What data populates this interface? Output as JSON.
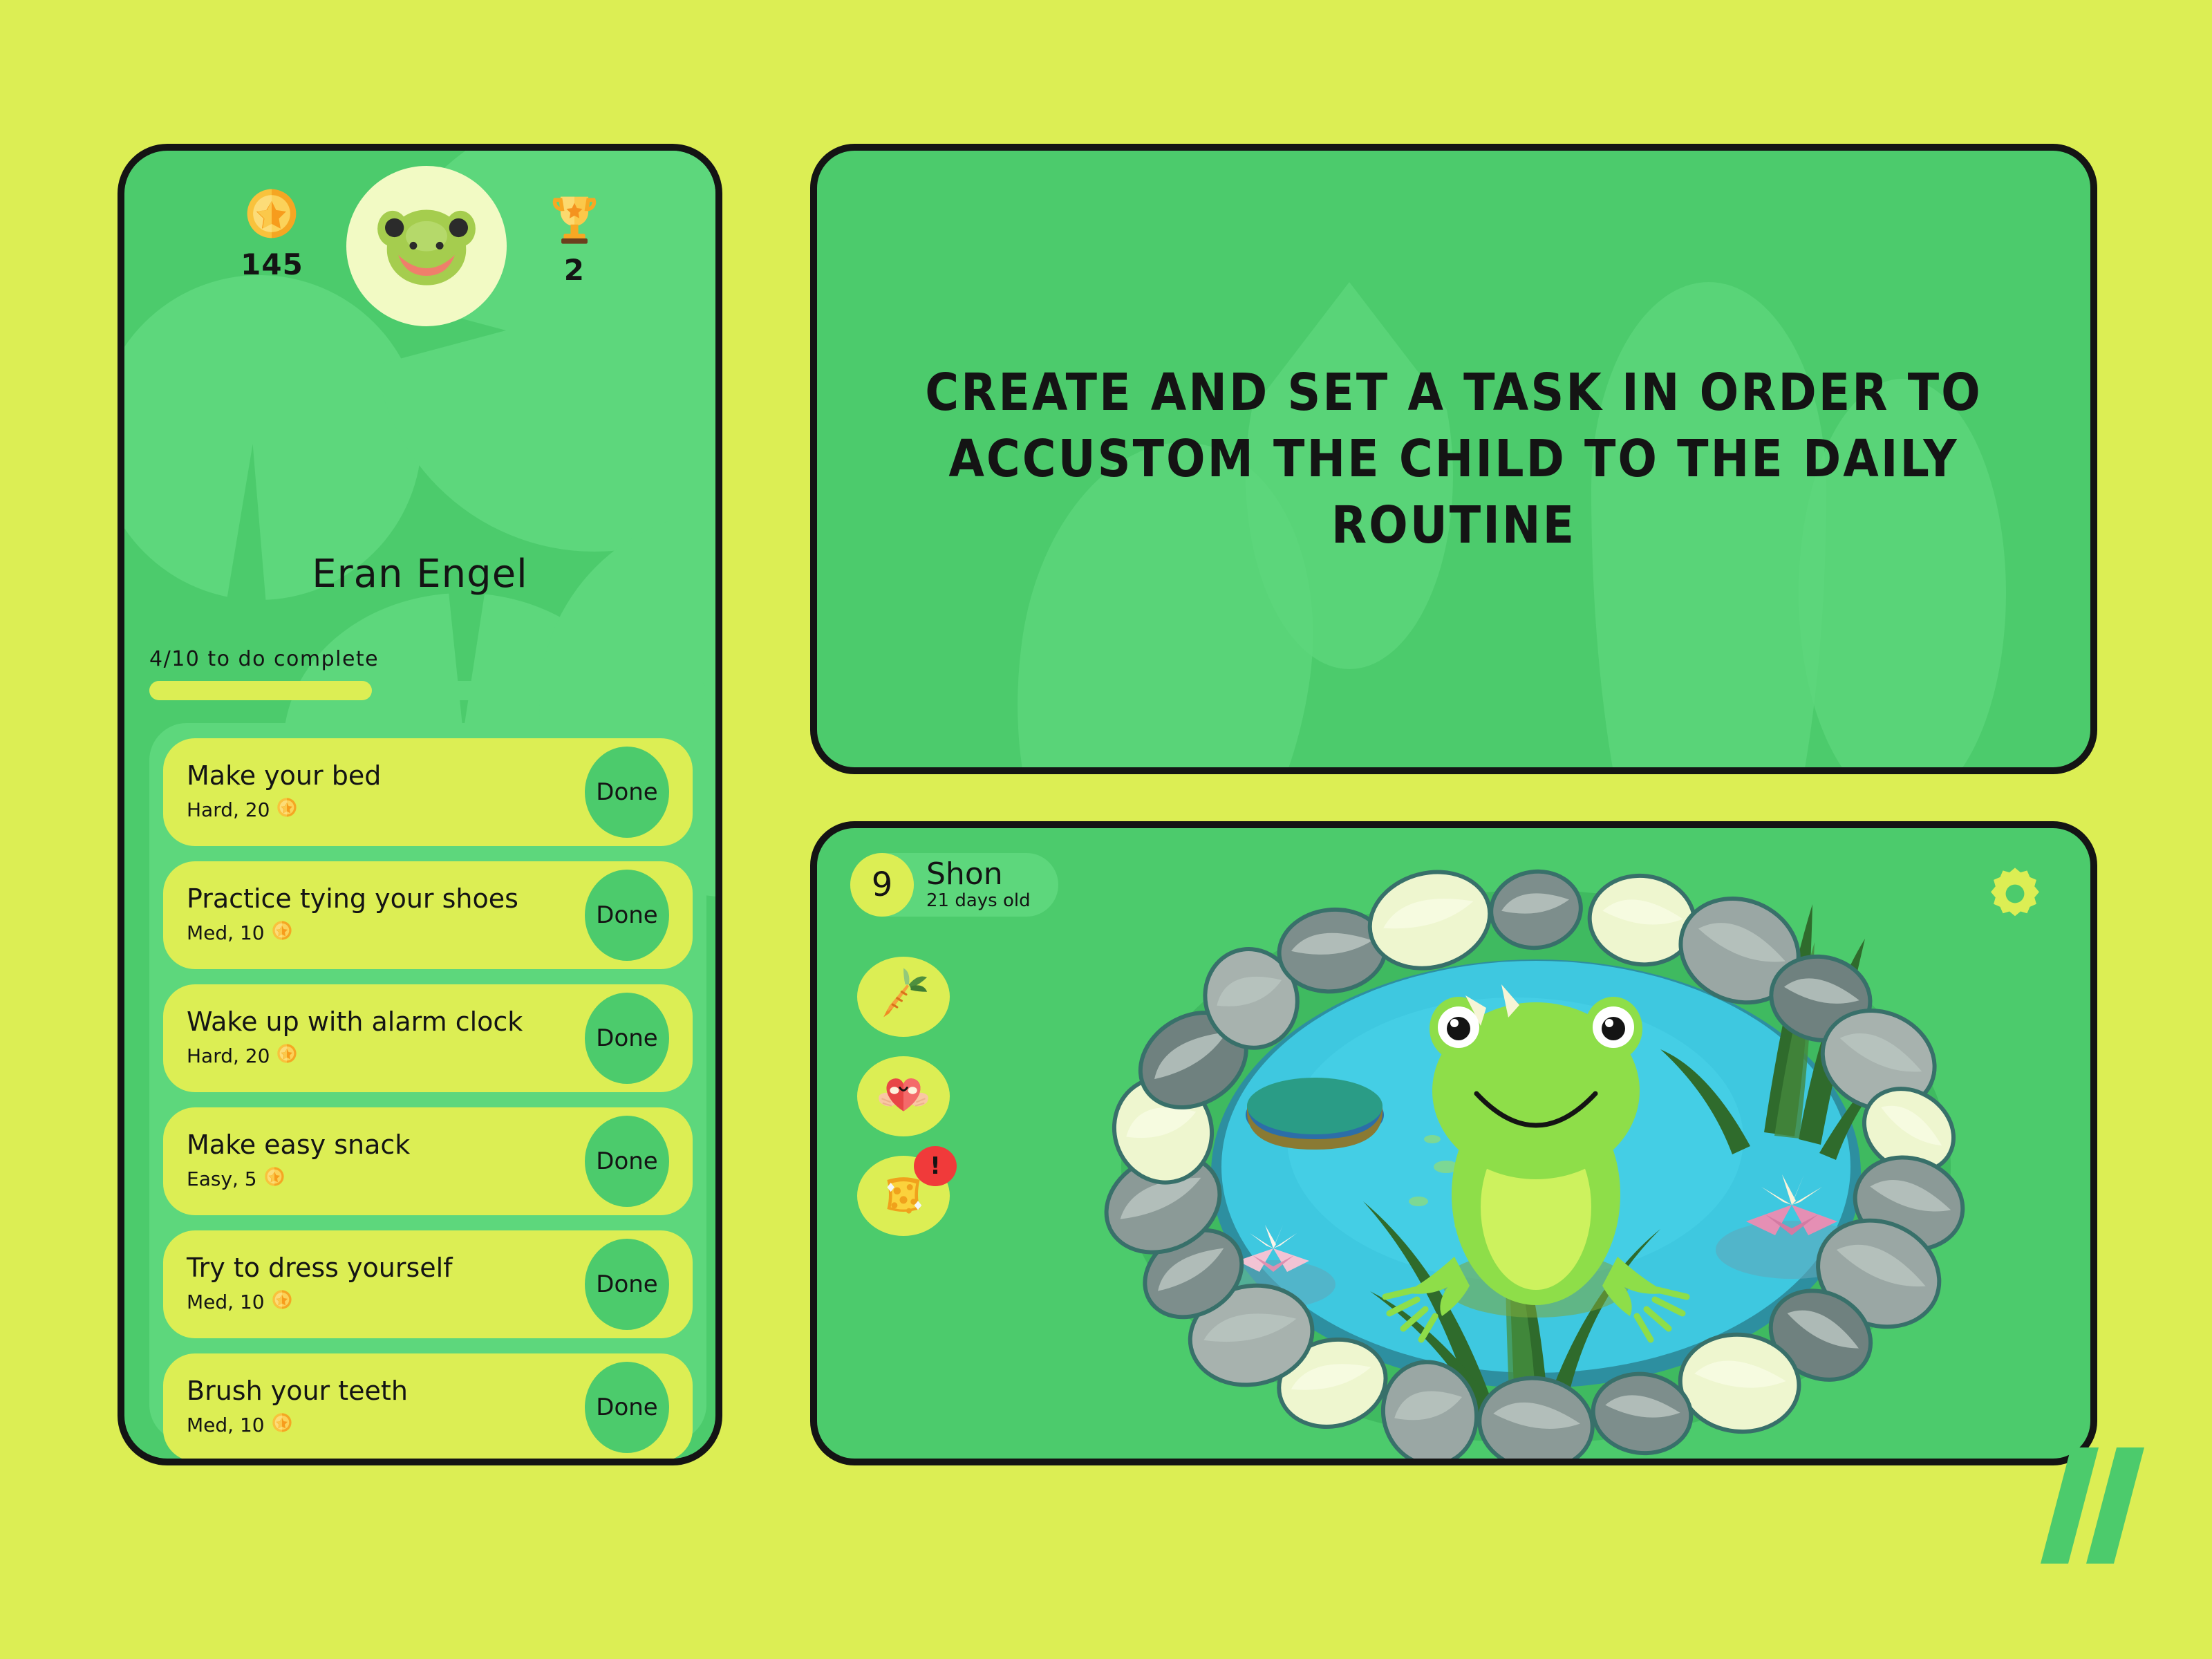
{
  "theme": {
    "bg": "#dcee54",
    "panel_green": "#4ccb6c",
    "panel_green_light": "#5dd77c",
    "card_yellow": "#dcee54",
    "ink": "#141414",
    "alert_red": "#f03a3a",
    "coin_gold": "#f7b731",
    "pond_water": "#3ec8e0"
  },
  "profile": {
    "coins_icon": "coin-star-icon",
    "coins": "145",
    "avatar_icon": "frog-avatar-icon",
    "trophy_icon": "trophy-icon",
    "trophies": "2",
    "name": "Eran Engel",
    "progress_label": "4/10 to do complete",
    "progress_done": 4,
    "progress_total": 10,
    "progress_percent": 40
  },
  "tasks": {
    "done_label": "Done",
    "items": [
      {
        "title": "Make your bed",
        "meta": "Hard, 20",
        "difficulty": "Hard",
        "reward": "20"
      },
      {
        "title": "Practice tying your shoes",
        "meta": "Med, 10",
        "difficulty": "Med",
        "reward": "10"
      },
      {
        "title": "Wake up with alarm clock",
        "meta": "Hard, 20",
        "difficulty": "Hard",
        "reward": "20"
      },
      {
        "title": "Make easy snack",
        "meta": "Easy, 5",
        "difficulty": "Easy",
        "reward": "5"
      },
      {
        "title": "Try to dress yourself",
        "meta": "Med, 10",
        "difficulty": "Med",
        "reward": "10"
      },
      {
        "title": "Brush your teeth",
        "meta": "Med, 10",
        "difficulty": "Med",
        "reward": "10"
      }
    ]
  },
  "header": {
    "title": "CREATE AND SET A TASK IN ORDER TO ACCUSTOM THE CHILD TO THE DAILY ROUTINE"
  },
  "pet": {
    "level": "9",
    "name": "Shon",
    "age": "21 days old",
    "settings_icon": "gear-icon",
    "actions": [
      {
        "name": "feed-action",
        "icon": "carrot-icon",
        "alert": false
      },
      {
        "name": "love-action",
        "icon": "heart-hands-icon",
        "alert": false
      },
      {
        "name": "clean-action",
        "icon": "sponge-icon",
        "alert": true,
        "alert_mark": "!"
      }
    ],
    "scene": "frog-in-pond"
  },
  "branding": {
    "logo_icon": "double-slash-logo"
  }
}
